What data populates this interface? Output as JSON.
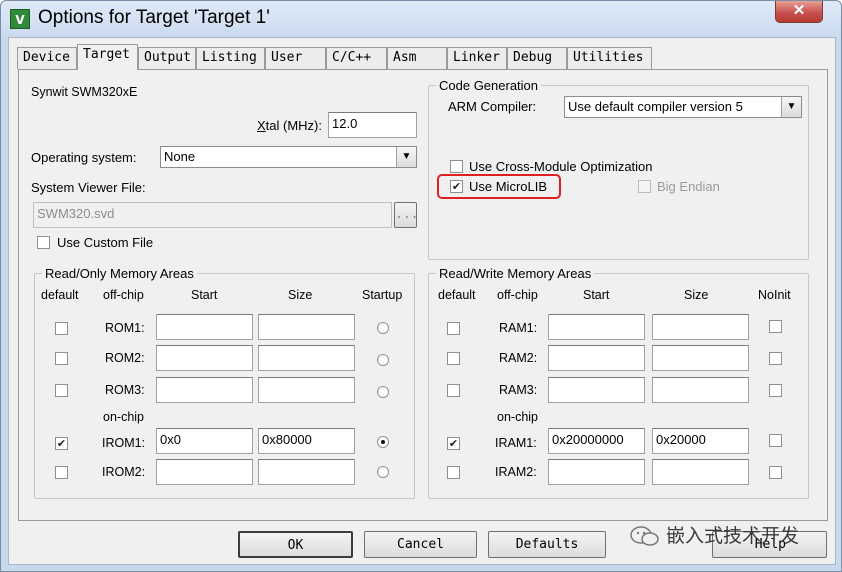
{
  "window": {
    "title": "Options for Target 'Target 1'",
    "app_icon": "uvision-icon",
    "close_label": "✕"
  },
  "tabs": [
    {
      "label": "Device",
      "selected": false
    },
    {
      "label": "Target",
      "selected": true
    },
    {
      "label": "Output",
      "selected": false
    },
    {
      "label": "Listing",
      "selected": false
    },
    {
      "label": "User",
      "selected": false
    },
    {
      "label": "C/C++",
      "selected": false
    },
    {
      "label": "Asm",
      "selected": false
    },
    {
      "label": "Linker",
      "selected": false
    },
    {
      "label": "Debug",
      "selected": false
    },
    {
      "label": "Utilities",
      "selected": false
    }
  ],
  "device": {
    "name": "Synwit SWM320xE",
    "xtal_prefix": "X",
    "xtal_rest": "tal (MHz):",
    "xtal_value": "12.0",
    "os_label": "Operating system:",
    "os_value": "None",
    "svd_label": "System Viewer File:",
    "svd_value": "SWM320.svd",
    "browse_label": "...",
    "custom_file_label": "Use Custom File"
  },
  "codegen": {
    "title": "Code Generation",
    "compiler_label": "ARM Compiler:",
    "compiler_value": "Use default compiler version 5",
    "cross_module_label": "Use Cross-Module Optimization",
    "cross_module_checked": false,
    "microlib_label": "Use MicroLIB",
    "microlib_checked": true,
    "big_endian_label": "Big Endian",
    "big_endian_checked": false
  },
  "ro_memory": {
    "title": "Read/Only Memory Areas",
    "headers": {
      "default": "default",
      "offchip": "off-chip",
      "start": "Start",
      "size": "Size",
      "startup": "Startup"
    },
    "onchip_label": "on-chip",
    "rows": [
      {
        "name": "ROM1:",
        "default": false,
        "start": "",
        "size": "",
        "startup": false
      },
      {
        "name": "ROM2:",
        "default": false,
        "start": "",
        "size": "",
        "startup": false
      },
      {
        "name": "ROM3:",
        "default": false,
        "start": "",
        "size": "",
        "startup": false
      },
      {
        "name": "IROM1:",
        "default": true,
        "start": "0x0",
        "size": "0x80000",
        "startup": true
      },
      {
        "name": "IROM2:",
        "default": false,
        "start": "",
        "size": "",
        "startup": false
      }
    ]
  },
  "rw_memory": {
    "title": "Read/Write Memory Areas",
    "headers": {
      "default": "default",
      "offchip": "off-chip",
      "start": "Start",
      "size": "Size",
      "noinit": "NoInit"
    },
    "onchip_label": "on-chip",
    "rows": [
      {
        "name": "RAM1:",
        "default": false,
        "start": "",
        "size": "",
        "noinit": false
      },
      {
        "name": "RAM2:",
        "default": false,
        "start": "",
        "size": "",
        "noinit": false
      },
      {
        "name": "RAM3:",
        "default": false,
        "start": "",
        "size": "",
        "noinit": false
      },
      {
        "name": "IRAM1:",
        "default": true,
        "start": "0x20000000",
        "size": "0x20000",
        "noinit": false
      },
      {
        "name": "IRAM2:",
        "default": false,
        "start": "",
        "size": "",
        "noinit": false
      }
    ]
  },
  "buttons": {
    "ok": "OK",
    "cancel": "Cancel",
    "defaults": "Defaults",
    "help": "Help"
  },
  "watermark": {
    "text": "嵌入式技术开发",
    "icon": "wechat-icon"
  }
}
